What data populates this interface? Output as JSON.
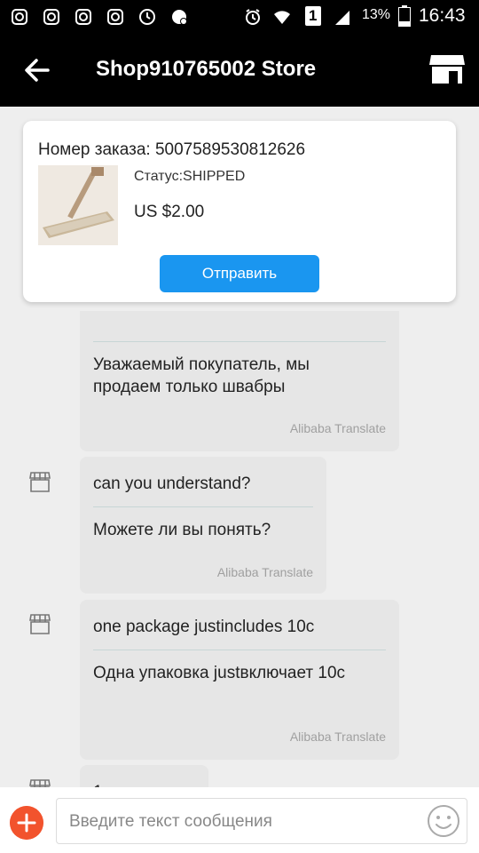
{
  "status_bar": {
    "battery": "13%",
    "time": "16:43",
    "sim": "1"
  },
  "app_bar": {
    "title": "Shop910765002 Store"
  },
  "order_card": {
    "order_number_label": "Номер заказа: 5007589530812626",
    "status": "Статус:SHIPPED",
    "price": "US $2.00",
    "send_label": "Отправить"
  },
  "messages": [
    {
      "translated": "Уважаемый покупатель, мы продаем только швабры",
      "source": "Alibaba Translate"
    },
    {
      "original": "can you understand?",
      "translated": "Можете ли вы понять?",
      "source": "Alibaba Translate"
    },
    {
      "original": "one package justincludes 10c",
      "translated": "Одна упаковка justвключает 10c",
      "source": "Alibaba Translate"
    },
    {
      "original": "1"
    }
  ],
  "composer": {
    "placeholder": "Введите текст сообщения"
  },
  "colors": {
    "accent": "#1a96f0",
    "plus_button": "#f2532d",
    "bubble": "#e6e6e6",
    "header": "#000000"
  }
}
